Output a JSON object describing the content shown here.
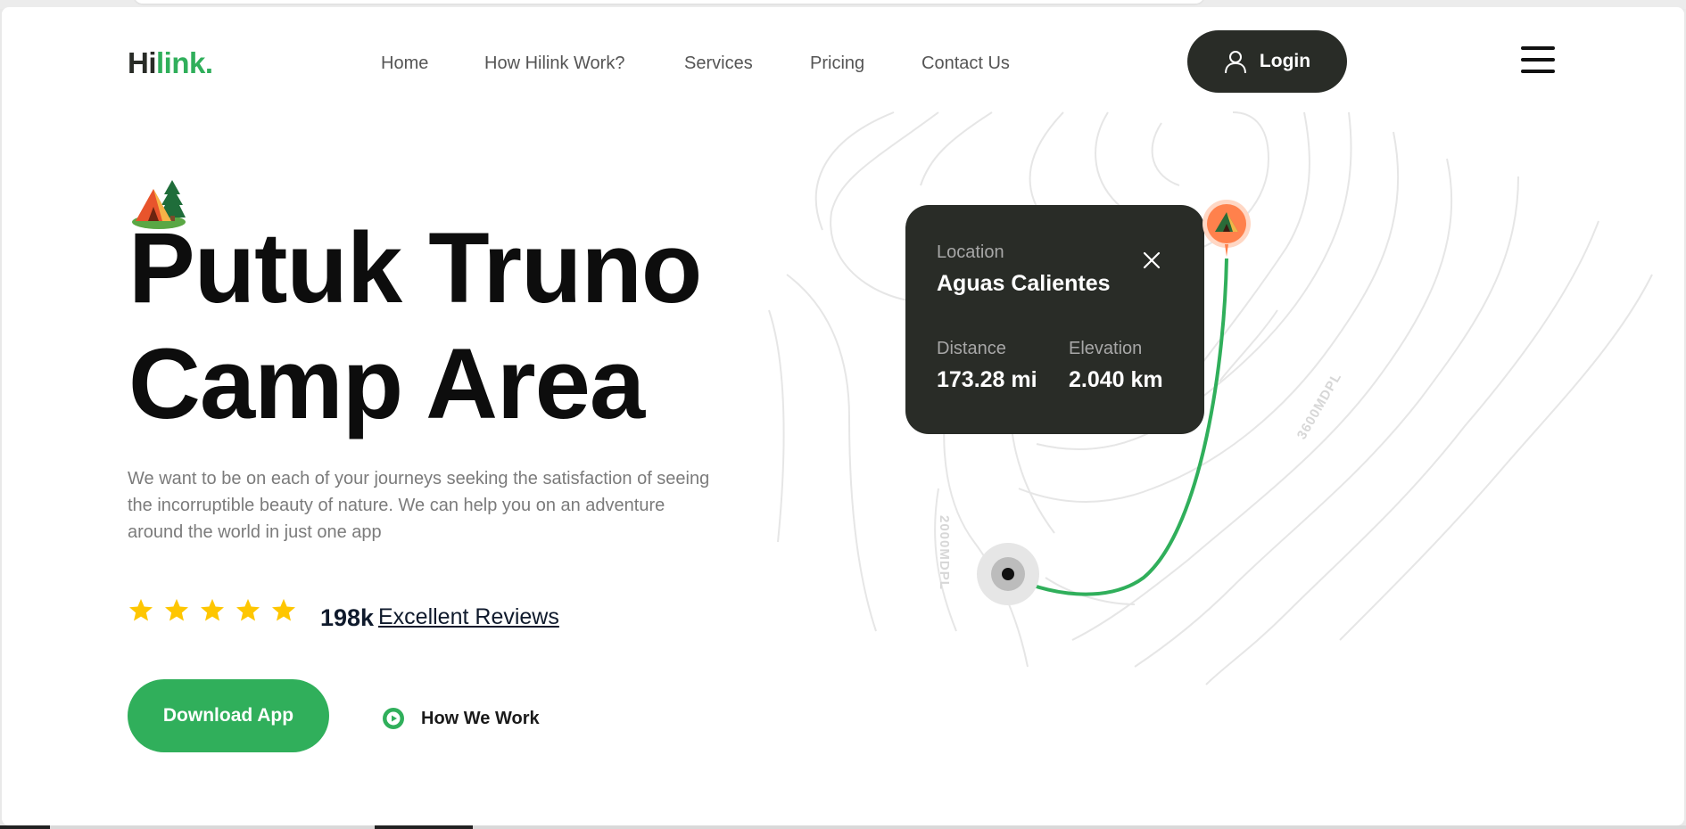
{
  "logo": {
    "part1": "Hi",
    "part2": "link."
  },
  "nav": [
    {
      "label": "Home"
    },
    {
      "label": "How Hilink Work?"
    },
    {
      "label": "Services"
    },
    {
      "label": "Pricing"
    },
    {
      "label": "Contact Us"
    }
  ],
  "header": {
    "login_label": "Login"
  },
  "hero": {
    "title_line1": "Putuk Truno",
    "title_line2": "Camp Area",
    "description": "We want to be on each of your journeys seeking the satisfaction of seeing the incorruptible beauty of nature. We can help you on an adventure around the world in just one app",
    "rating": 5,
    "reviews_count": "198k",
    "reviews_label": "Excellent Reviews",
    "download_label": "Download App",
    "how_label": "How We Work"
  },
  "map": {
    "contour_label_1": "2000MDPL",
    "contour_label_2": "3600MDPL"
  },
  "location_card": {
    "location_label": "Location",
    "location_value": "Aguas Calientes",
    "distance_label": "Distance",
    "distance_value": "173.28 mi",
    "elevation_label": "Elevation",
    "elevation_value": "2.040 km"
  },
  "colors": {
    "brand_green": "#30af5b",
    "dark": "#292c27",
    "star": "#fec601",
    "pin": "#ff814c"
  },
  "icons": [
    "user-icon",
    "menu-icon",
    "tent-icon",
    "star-icon",
    "play-icon",
    "close-icon",
    "map-pin-icon"
  ]
}
